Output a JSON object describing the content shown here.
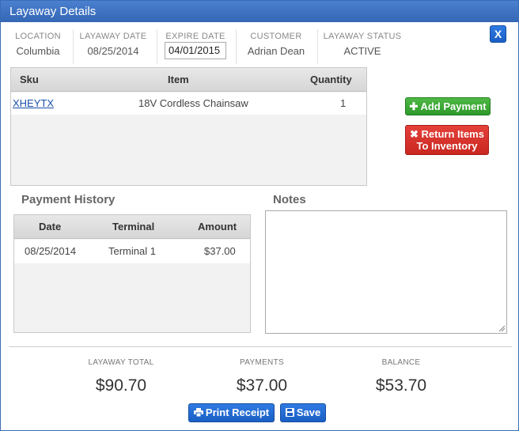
{
  "window": {
    "title": "Layaway Details",
    "close_label": "X"
  },
  "info": {
    "location_label": "LOCATION",
    "location_value": "Columbia",
    "layaway_date_label": "LAYAWAY DATE",
    "layaway_date_value": "08/25/2014",
    "expire_date_label": "EXPIRE DATE",
    "expire_date_value": "04/01/2015",
    "customer_label": "CUSTOMER",
    "customer_value": "Adrian Dean",
    "status_label": "LAYAWAY STATUS",
    "status_value": "ACTIVE"
  },
  "items_table": {
    "headers": {
      "sku": "Sku",
      "item": "Item",
      "quantity": "Quantity"
    },
    "rows": [
      {
        "sku": "XHEYTX",
        "item": "18V Cordless Chainsaw",
        "quantity": "1"
      }
    ]
  },
  "actions": {
    "add_payment": "Add Payment",
    "return_line1": "Return Items",
    "return_line2": "To Inventory"
  },
  "payment_history": {
    "title": "Payment History",
    "headers": {
      "date": "Date",
      "terminal": "Terminal",
      "amount": "Amount"
    },
    "rows": [
      {
        "date": "08/25/2014",
        "terminal": "Terminal 1",
        "amount": "$37.00"
      }
    ]
  },
  "notes": {
    "title": "Notes",
    "value": ""
  },
  "totals": {
    "total_label": "LAYAWAY TOTAL",
    "total_value": "$90.70",
    "payments_label": "PAYMENTS",
    "payments_value": "$37.00",
    "balance_label": "BALANCE",
    "balance_value": "$53.70"
  },
  "footer": {
    "print_receipt": "Print Receipt",
    "save": "Save"
  },
  "colors": {
    "titlebar": "#3a6cb5",
    "green": "#3aa834",
    "red": "#d32f27",
    "blue": "#1f66cf"
  }
}
